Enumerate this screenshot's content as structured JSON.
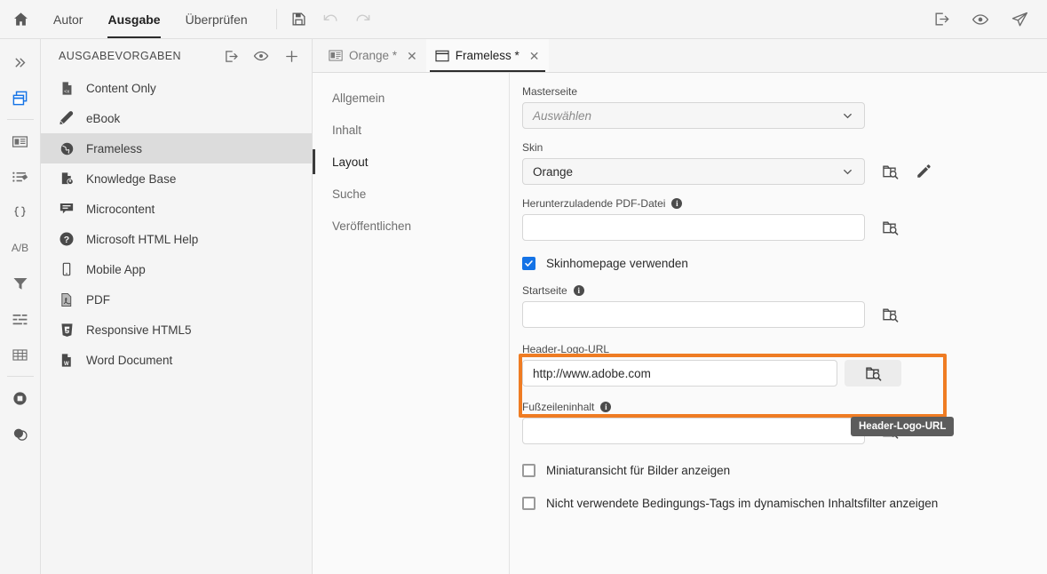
{
  "topbar": {
    "home_icon": "home-icon",
    "menu": [
      {
        "label": "Autor",
        "active": false
      },
      {
        "label": "Ausgabe",
        "active": true
      },
      {
        "label": "Überprüfen",
        "active": false
      }
    ],
    "tools": [
      {
        "name": "save-icon",
        "disabled": false
      },
      {
        "name": "undo-icon",
        "disabled": true
      },
      {
        "name": "redo-icon",
        "disabled": true
      }
    ],
    "right_icons": [
      {
        "name": "publish-export-icon"
      },
      {
        "name": "preview-eye-icon"
      },
      {
        "name": "send-paper-plane-icon"
      }
    ]
  },
  "rail": {
    "items": [
      {
        "name": "expand-chevrons-icon",
        "selected": false
      },
      {
        "name": "output-presets-icon",
        "selected": true
      },
      {
        "name": "master-pages-icon",
        "selected": false
      },
      {
        "name": "snippets-tags-icon",
        "selected": false
      },
      {
        "name": "variables-braces-icon",
        "selected": false
      },
      {
        "name": "ab-conditions-icon",
        "selected": false
      },
      {
        "name": "filter-funnel-icon",
        "selected": false
      },
      {
        "name": "condition-expression-icon",
        "selected": false
      },
      {
        "name": "table-styles-icon",
        "selected": false
      },
      {
        "name": "stop-circle-icon",
        "selected": false
      },
      {
        "name": "skins-layers-icon",
        "selected": false
      }
    ]
  },
  "presets": {
    "title": "AUSGABEVORGABEN",
    "head_icons": [
      {
        "name": "generate-output-icon"
      },
      {
        "name": "view-output-eye-icon"
      },
      {
        "name": "add-preset-plus-icon"
      }
    ],
    "items": [
      {
        "label": "Content Only",
        "icon": "content-only-icon",
        "selected": false
      },
      {
        "label": "eBook",
        "icon": "ebook-icon",
        "selected": false
      },
      {
        "label": "Frameless",
        "icon": "frameless-globe-icon",
        "selected": true
      },
      {
        "label": "Knowledge Base",
        "icon": "knowledge-base-icon",
        "selected": false
      },
      {
        "label": "Microcontent",
        "icon": "microcontent-icon",
        "selected": false
      },
      {
        "label": "Microsoft HTML Help",
        "icon": "ms-html-help-icon",
        "selected": false
      },
      {
        "label": "Mobile App",
        "icon": "mobile-app-icon",
        "selected": false
      },
      {
        "label": "PDF",
        "icon": "pdf-icon",
        "selected": false
      },
      {
        "label": "Responsive HTML5",
        "icon": "html5-icon",
        "selected": false
      },
      {
        "label": "Word Document",
        "icon": "word-document-icon",
        "selected": false
      }
    ]
  },
  "tabs": [
    {
      "label": "Orange *",
      "icon": "master-page-icon",
      "active": false,
      "close": "✕"
    },
    {
      "label": "Frameless *",
      "icon": "output-preset-icon",
      "active": true,
      "close": "✕"
    }
  ],
  "subnav": {
    "items": [
      {
        "label": "Allgemein",
        "selected": false
      },
      {
        "label": "Inhalt",
        "selected": false
      },
      {
        "label": "Layout",
        "selected": true
      },
      {
        "label": "Suche",
        "selected": false
      },
      {
        "label": "Veröffentlichen",
        "selected": false
      }
    ]
  },
  "form": {
    "masterseite": {
      "label": "Masterseite",
      "value": "",
      "placeholder": "Auswählen",
      "has_info": false
    },
    "skin": {
      "label": "Skin",
      "value": "Orange",
      "has_info": false,
      "browse_icon": "browse-folder-search-icon",
      "edit_icon": "edit-pencil-icon"
    },
    "pdf_datei": {
      "label": "Herunterzuladende PDF-Datei",
      "value": "",
      "has_info": true,
      "browse_icon": "browse-folder-search-icon"
    },
    "skinhomepage": {
      "label": "Skinhomepage verwenden",
      "checked": true
    },
    "startseite": {
      "label": "Startseite",
      "value": "",
      "has_info": true,
      "browse_icon": "browse-folder-search-icon"
    },
    "header_logo_url": {
      "label": "Header-Logo-URL",
      "value": "http://www.adobe.com",
      "has_info": false,
      "browse_icon": "browse-folder-search-icon",
      "highlighted": true,
      "tooltip": "Header-Logo-URL"
    },
    "fusszeileninhalt": {
      "label": "Fußzeileninhalt",
      "value": "",
      "has_info": true,
      "browse_icon": "browse-folder-search-icon"
    },
    "thumbnails": {
      "label": "Miniaturansicht für Bilder anzeigen",
      "checked": false
    },
    "unused_tags": {
      "label": "Nicht verwendete Bedingungs-Tags im dynamischen Inhaltsfilter anzeigen",
      "checked": false
    }
  },
  "colors": {
    "highlight_orange": "#ef7c23",
    "tooltip_bg": "#5c5c5c",
    "checkbox_blue": "#1473e6",
    "panel_bg": "#fafafa",
    "sidebar_bg": "#f5f5f5",
    "selected_row": "#dcdcdc"
  }
}
